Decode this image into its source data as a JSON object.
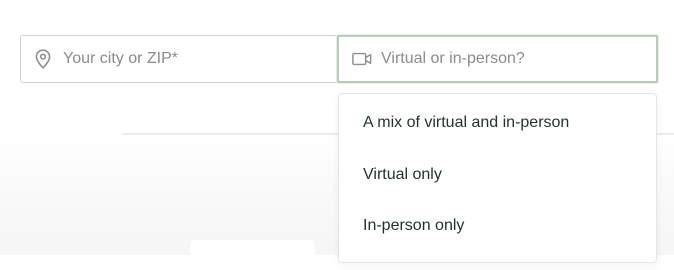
{
  "search": {
    "location": {
      "icon": "map-pin-icon",
      "placeholder": "Your city or ZIP*",
      "value": ""
    },
    "format": {
      "icon": "video-camera-icon",
      "placeholder": "Virtual or in-person?",
      "value": "",
      "focused": true,
      "options": [
        "A mix of virtual and in-person",
        "Virtual only",
        "In-person only"
      ]
    }
  },
  "colors": {
    "focus_border": "#b6ceb8",
    "option_text": "#1f3328",
    "placeholder_text": "#8b8b8b",
    "icon_color": "#8f8f8f"
  }
}
